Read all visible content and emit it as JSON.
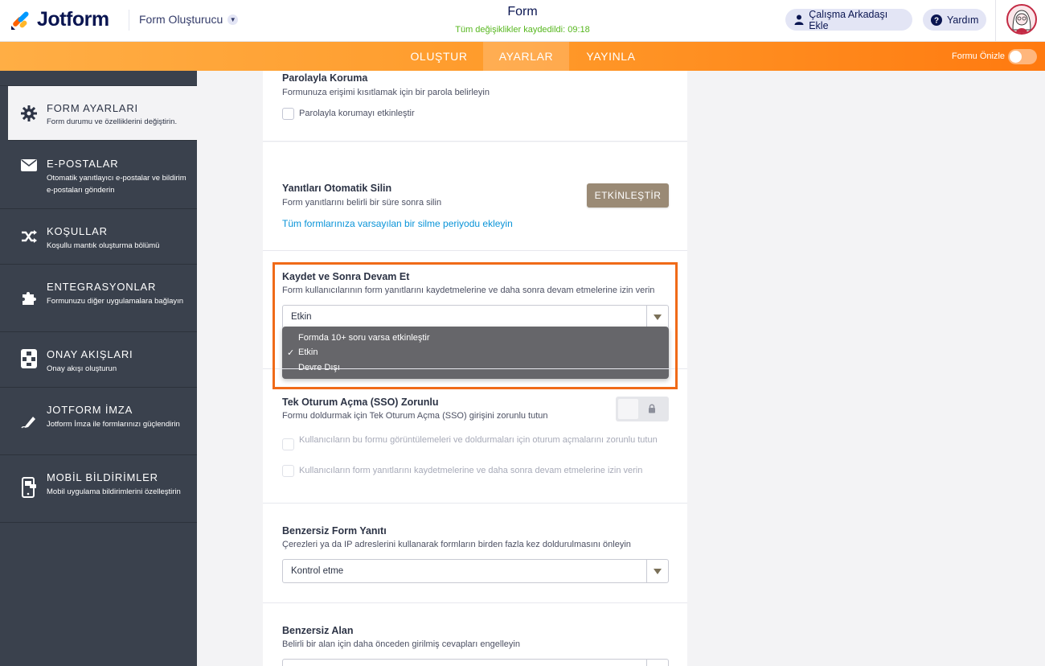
{
  "header": {
    "logo_text": "Jotform",
    "builder_label": "Form Oluşturucu",
    "form_title": "Form",
    "save_status": "Tüm değişiklikler kaydedildi: 09:18",
    "add_teammate_label": "Çalışma Arkadaşı Ekle",
    "help_label": "Yardım"
  },
  "nav": {
    "tabs": [
      {
        "label": "OLUŞTUR"
      },
      {
        "label": "AYARLAR"
      },
      {
        "label": "YAYINLA"
      }
    ],
    "active_tab": "AYARLAR",
    "preview_label": "Formu Önizle"
  },
  "sidebar": {
    "items": [
      {
        "title": "FORM AYARLARI",
        "desc": "Form durumu ve özelliklerini değiştirin.",
        "icon": "gear-icon",
        "active": true
      },
      {
        "title": "E-POSTALAR",
        "desc": "Otomatik yanıtlayıcı e-postalar ve bildirim e-postaları gönderin",
        "icon": "envelope-icon"
      },
      {
        "title": "KOŞULLAR",
        "desc": "Koşullu mantık oluşturma bölümü",
        "icon": "shuffle-icon"
      },
      {
        "title": "ENTEGRASYONLAR",
        "desc": "Formunuzu diğer uygulamalara bağlayın",
        "icon": "puzzle-icon"
      },
      {
        "title": "ONAY AKIŞLARI",
        "desc": "Onay akışı oluşturun",
        "icon": "flow-icon"
      },
      {
        "title": "JOTFORM İMZA",
        "desc": "Jotform İmza ile formlarınızı güçlendirin",
        "icon": "pen-icon"
      },
      {
        "title": "MOBİL BİLDİRİMLER",
        "desc": "Mobil uygulama bildirimlerini özelleştirin",
        "icon": "mobile-icon"
      }
    ]
  },
  "settings": {
    "password": {
      "title": "Parolayla Koruma",
      "desc": "Formunuza erişimi kısıtlamak için bir parola belirleyin",
      "checkbox_label": "Parolayla korumayı etkinleştir"
    },
    "auto_delete": {
      "title": "Yanıtları Otomatik Silin",
      "desc": "Form yanıtlarını belirli bir süre sonra silin",
      "button_label": "ETKİNLEŞTİR",
      "link_text": "Tüm formlarınıza varsayılan bir silme periyodu ekleyin"
    },
    "save_continue": {
      "title": "Kaydet ve Sonra Devam Et",
      "desc": "Form kullanıcılarının form yanıtlarını kaydetmelerine ve daha sonra devam etmelerine izin verin",
      "selected": "Etkin",
      "options": [
        "Formda 10+ soru varsa etkinleştir",
        "Etkin",
        "Devre Dışı"
      ],
      "check_mark": "✓"
    },
    "sso": {
      "title": "Tek Oturum Açma (SSO) Zorunlu",
      "desc": "Formu doldurmak için Tek Oturum Açma (SSO) girişini zorunlu tutun",
      "option1": "Kullanıcıların bu formu görüntülemeleri ve doldurmaları için oturum açmalarını zorunlu tutun",
      "option2": "Kullanıcıların form yanıtlarını kaydetmelerine ve daha sonra devam etmelerine izin verin"
    },
    "unique_submission": {
      "title": "Benzersiz Form Yanıtı",
      "desc": "Çerezleri ya da IP adreslerini kullanarak formların birden fazla kez doldurulmasını önleyin",
      "selected": "Kontrol etme"
    },
    "unique_field": {
      "title": "Benzersiz Alan",
      "desc": "Belirli bir alan için daha önceden girilmiş cevapları engelleyin"
    }
  },
  "colors": {
    "accent_orange": "#ff7a10",
    "sidebar_bg": "#3a414d",
    "highlight_border": "#f06a18",
    "saved_green": "#57b71f"
  }
}
